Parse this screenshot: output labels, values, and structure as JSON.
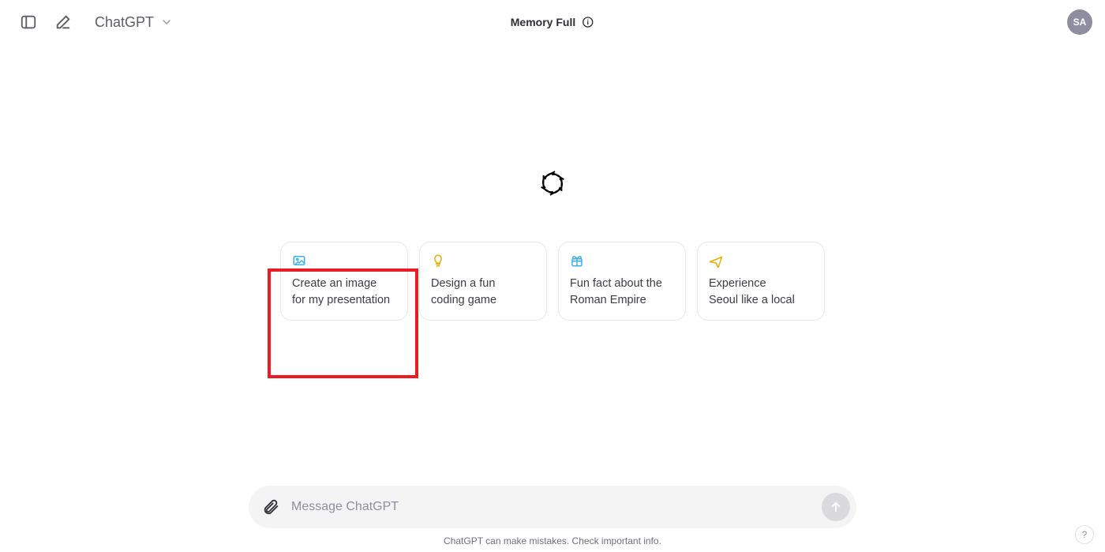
{
  "header": {
    "model_label": "ChatGPT",
    "memory_label": "Memory Full",
    "avatar_initials": "SA"
  },
  "cards": [
    {
      "icon": "image-icon",
      "line1": "Create an image",
      "line2": "for my presentation",
      "color": "#3db2ea"
    },
    {
      "icon": "bulb-icon",
      "line1": "Design a fun",
      "line2": "coding game",
      "color": "#e6b100"
    },
    {
      "icon": "gift-icon",
      "line1": "Fun fact about the",
      "line2": "Roman Empire",
      "color": "#3db2ea"
    },
    {
      "icon": "plane-icon",
      "line1": "Experience",
      "line2": "Seoul like a local",
      "color": "#e6b100"
    }
  ],
  "input": {
    "placeholder": "Message ChatGPT"
  },
  "footnote": "ChatGPT can make mistakes. Check important info.",
  "help_label": "?",
  "highlight": {
    "target_card_index": 0
  }
}
